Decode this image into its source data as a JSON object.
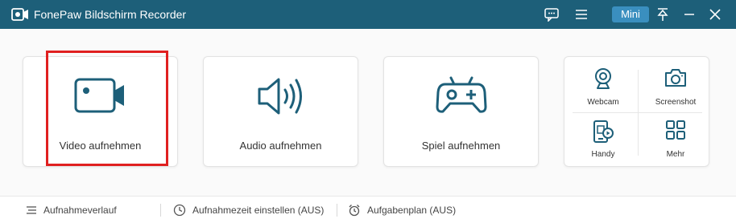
{
  "window": {
    "title": "FonePaw Bildschirm Recorder",
    "mini_label": "Mini"
  },
  "titlebar_icons": [
    "feedback-icon",
    "menu-icon",
    "pin-icon",
    "minimize-icon",
    "close-icon"
  ],
  "modes": [
    {
      "label": "Video aufnehmen",
      "icon": "video-camera-icon"
    },
    {
      "label": "Audio aufnehmen",
      "icon": "speaker-icon"
    },
    {
      "label": "Spiel aufnehmen",
      "icon": "gamepad-icon"
    }
  ],
  "tools": [
    {
      "label": "Webcam",
      "icon": "webcam-icon"
    },
    {
      "label": "Screenshot",
      "icon": "camera-icon"
    },
    {
      "label": "Handy",
      "icon": "phone-icon"
    },
    {
      "label": "Mehr",
      "icon": "grid-icon"
    }
  ],
  "statusbar": {
    "history": "Aufnahmeverlauf",
    "timer": "Aufnahmezeit einstellen (AUS)",
    "schedule": "Aufgabenplan (AUS)"
  },
  "colors": {
    "titlebar": "#1d5f79",
    "accent": "#1d5f79",
    "mini_button": "#3a8fbf",
    "highlight": "#e02020"
  }
}
